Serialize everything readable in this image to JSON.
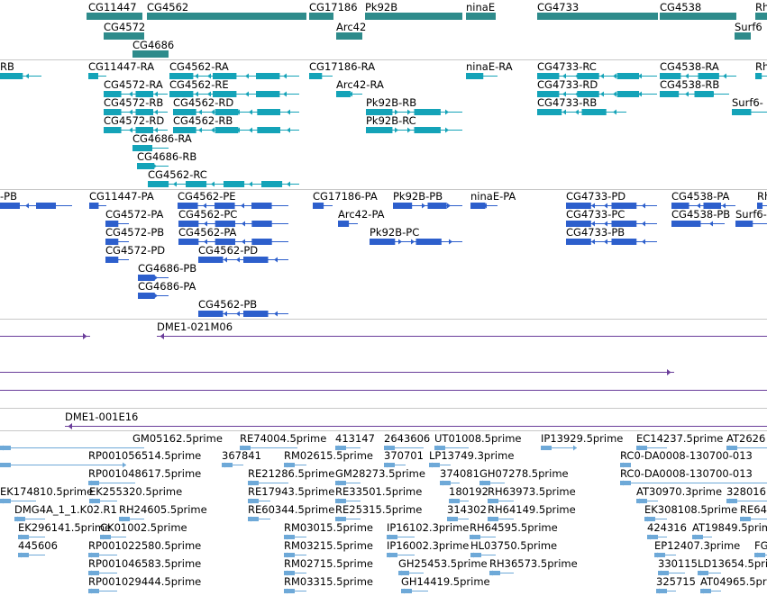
{
  "colors": {
    "genes": "#2e8b8b",
    "transcripts": "#14a3b8",
    "proteins": "#2d5fcc",
    "clones": "#6a3d9a",
    "ests": "#6ea9d8",
    "divider": "#c8c8c8"
  },
  "tracks": [
    {
      "id": "genes",
      "color_key": "genes",
      "features": [
        {
          "label": "CG11447"
        },
        {
          "label": "CG4562"
        },
        {
          "label": "CG17186"
        },
        {
          "label": "Pk92B"
        },
        {
          "label": "ninaE"
        },
        {
          "label": "CG4733"
        },
        {
          "label": "CG4538"
        },
        {
          "label": "Rh"
        },
        {
          "label": "CG4572"
        },
        {
          "label": "Arc42"
        },
        {
          "label": "Surf6"
        },
        {
          "label": "CG4686"
        }
      ]
    },
    {
      "id": "transcripts",
      "color_key": "transcripts",
      "features": [
        {
          "label": "RB"
        },
        {
          "label": "CG11447-RA"
        },
        {
          "label": "CG4562-RA"
        },
        {
          "label": "CG17186-RA"
        },
        {
          "label": "ninaE-RA"
        },
        {
          "label": "CG4733-RC"
        },
        {
          "label": "CG4538-RA"
        },
        {
          "label": "Rh"
        },
        {
          "label": "CG4572-RA"
        },
        {
          "label": "CG4562-RE"
        },
        {
          "label": "Arc42-RA"
        },
        {
          "label": "CG4733-RD"
        },
        {
          "label": "CG4538-RB"
        },
        {
          "label": "CG4572-RB"
        },
        {
          "label": "CG4562-RD"
        },
        {
          "label": "Pk92B-RB"
        },
        {
          "label": "CG4733-RB"
        },
        {
          "label": "Surf6-"
        },
        {
          "label": "CG4572-RD"
        },
        {
          "label": "CG4562-RB"
        },
        {
          "label": "Pk92B-RC"
        },
        {
          "label": "CG4686-RA"
        },
        {
          "label": "CG4686-RB"
        },
        {
          "label": "CG4562-RC"
        }
      ]
    },
    {
      "id": "proteins",
      "color_key": "proteins",
      "features": [
        {
          "label": "-PB"
        },
        {
          "label": "CG11447-PA"
        },
        {
          "label": "CG4562-PE"
        },
        {
          "label": "CG17186-PA"
        },
        {
          "label": "Pk92B-PB"
        },
        {
          "label": "ninaE-PA"
        },
        {
          "label": "CG4733-PD"
        },
        {
          "label": "CG4538-PA"
        },
        {
          "label": "Rh"
        },
        {
          "label": "CG4572-PA"
        },
        {
          "label": "CG4562-PC"
        },
        {
          "label": "Arc42-PA"
        },
        {
          "label": "CG4733-PC"
        },
        {
          "label": "CG4538-PB"
        },
        {
          "label": "Surf6-"
        },
        {
          "label": "CG4572-PB"
        },
        {
          "label": "CG4562-PA"
        },
        {
          "label": "Pk92B-PC"
        },
        {
          "label": "CG4733-PB"
        },
        {
          "label": "CG4572-PD"
        },
        {
          "label": "CG4562-PD"
        },
        {
          "label": "CG4686-PB"
        },
        {
          "label": "CG4686-PA"
        },
        {
          "label": "CG4562-PB"
        }
      ]
    },
    {
      "id": "clones",
      "color_key": "clones",
      "features": [
        {
          "label": "DME1-021M06"
        },
        {
          "label": ""
        },
        {
          "label": ""
        },
        {
          "label": ""
        },
        {
          "label": "DME1-001E16"
        }
      ]
    },
    {
      "id": "ests",
      "color_key": "ests",
      "features": [
        {
          "label": "GM05162.5prime"
        },
        {
          "label": "RE74004.5prime"
        },
        {
          "label": "413147"
        },
        {
          "label": "2643606"
        },
        {
          "label": "UT01008.5prime"
        },
        {
          "label": "IP13929.5prime"
        },
        {
          "label": "EC14237.5prime"
        },
        {
          "label": "AT2626"
        },
        {
          "label": "RP001056514.5prime"
        },
        {
          "label": "367841"
        },
        {
          "label": "RM02615.5prime"
        },
        {
          "label": "370701"
        },
        {
          "label": "LP13749.3prime"
        },
        {
          "label": "RC0-DA0008-130700-013"
        },
        {
          "label": "RP001048617.5prime"
        },
        {
          "label": "RE21286.5prime"
        },
        {
          "label": "GM28273.5prime"
        },
        {
          "label": "374081"
        },
        {
          "label": "GH07278.5prime"
        },
        {
          "label": "RC0-DA0008-130700-013"
        },
        {
          "label": "EK174810.5prime"
        },
        {
          "label": "EK255320.5prime"
        },
        {
          "label": "RE17943.5prime"
        },
        {
          "label": "RE33501.5prime"
        },
        {
          "label": "180192"
        },
        {
          "label": "RH63973.5prime"
        },
        {
          "label": "AT30970.3prime"
        },
        {
          "label": "328016"
        },
        {
          "label": "DMG4A_1_1.K02.R1"
        },
        {
          "label": "RH24605.5prime"
        },
        {
          "label": "RE60344.5prime"
        },
        {
          "label": "RE25315.5prime"
        },
        {
          "label": "314302"
        },
        {
          "label": "RH64149.5prime"
        },
        {
          "label": "EK308108.5prime"
        },
        {
          "label": "RE64"
        },
        {
          "label": "EK296141.5prime"
        },
        {
          "label": "CK01002.5prime"
        },
        {
          "label": "RM03015.5prime"
        },
        {
          "label": "IP16102.3prime"
        },
        {
          "label": "RH64595.5prime"
        },
        {
          "label": "424316"
        },
        {
          "label": "AT19849.5prime"
        },
        {
          "label": "445606"
        },
        {
          "label": "RP001022580.5prime"
        },
        {
          "label": "RM03215.5prime"
        },
        {
          "label": "IP16002.3prime"
        },
        {
          "label": "HL03750.5prime"
        },
        {
          "label": "EP12407.3prime"
        },
        {
          "label": "FGM"
        },
        {
          "label": "RP001046583.5prime"
        },
        {
          "label": "RM02715.5prime"
        },
        {
          "label": "GH25453.5prime"
        },
        {
          "label": "RH36573.5prime"
        },
        {
          "label": "330115"
        },
        {
          "label": "LD13654.5prime"
        },
        {
          "label": "RP001029444.5prime"
        },
        {
          "label": "RM03315.5prime"
        },
        {
          "label": "GH14419.5prime"
        },
        {
          "label": "325715"
        },
        {
          "label": "AT04965.5prime"
        }
      ]
    }
  ]
}
